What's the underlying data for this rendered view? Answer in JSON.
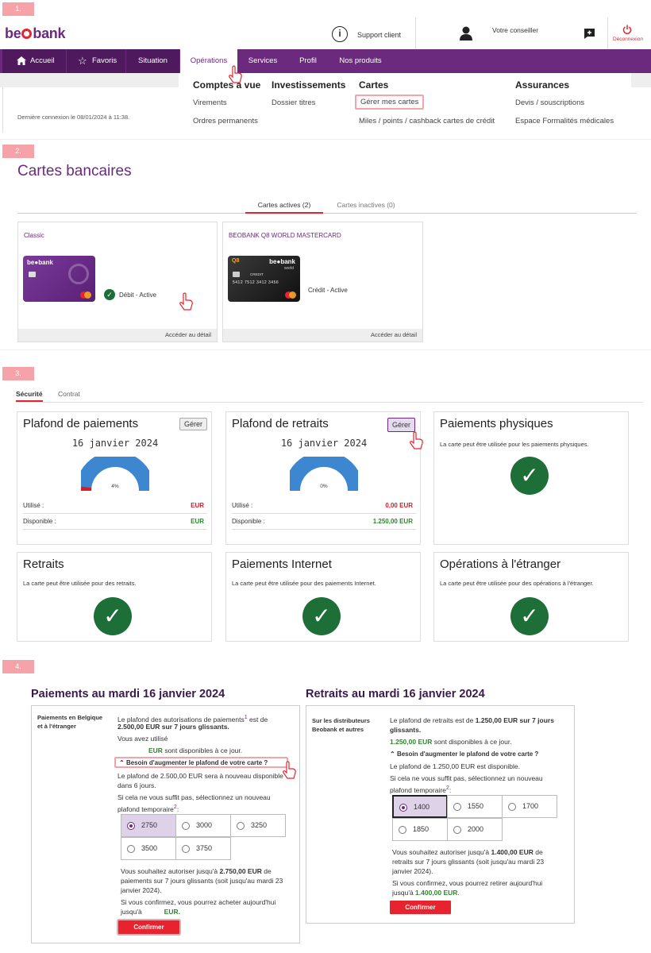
{
  "steps": [
    "1.",
    "2.",
    "3.",
    "4."
  ],
  "header": {
    "logo_pre": "be",
    "logo_post": "bank",
    "support": "Support client",
    "advisor": "Votre conseiller",
    "logout": "Déconnexion"
  },
  "nav": {
    "items": [
      "Accueil",
      "Favoris",
      "Situation",
      "Opérations",
      "Services",
      "Profil",
      "Nos produits"
    ]
  },
  "mega": {
    "heads": [
      "Comptes à vue",
      "Investissements",
      "Cartes",
      "Assurances"
    ],
    "links": {
      "virements": "Virements",
      "ordres": "Ordres permanents",
      "dossier": "Dossier titres",
      "gerer": "Gérer mes cartes",
      "miles": "Miles / points / cashback cartes de crédit",
      "devis": "Devis / souscriptions",
      "espace": "Espace Formalités médicales"
    }
  },
  "last_login": "Dernière connexion le 08/01/2024 à 11:38.",
  "cards_page": {
    "title": "Cartes bancaires",
    "tabs": [
      "Cartes actives (2)",
      "Cartes inactives (0)"
    ],
    "cards": [
      {
        "name": "Classic",
        "status": "Débit - Active",
        "detail": "Accéder au détail"
      },
      {
        "name": "BEOBANK Q8 WORLD MASTERCARD",
        "status": "Crédit - Active",
        "detail": "Accéder au détail"
      }
    ],
    "card_print": {
      "brand_pre": "be",
      "brand_post": "bank",
      "world": "world",
      "number": "5412 7512 3412 3456",
      "credit": "CREDIT",
      "q8": "Q8"
    }
  },
  "security": {
    "tabs": [
      "Sécurité",
      "Contrat"
    ],
    "payments": {
      "title": "Plafond de paiements",
      "manage": "Gérer",
      "date": "16 janvier 2024",
      "pct_label": "4%",
      "pct_used": 0.04,
      "used_label": "Utilisé :",
      "used_value": "EUR",
      "avail_label": "Disponible :",
      "avail_value": "EUR"
    },
    "withdrawals": {
      "title": "Plafond de retraits",
      "manage": "Gérer",
      "date": "16 janvier 2024",
      "pct_label": "0%",
      "pct_used": 0.0,
      "used_label": "Utilisé :",
      "used_value": "0,00 EUR",
      "avail_label": "Disponible :",
      "avail_value": "1.250,00 EUR"
    },
    "tiles": [
      {
        "title": "Paiements physiques",
        "sub": "La carte peut être utilisée pour les paiements physiques."
      },
      {
        "title": "Retraits",
        "sub": "La carte peut être utilisée pour des retraits."
      },
      {
        "title": "Paiements Internet",
        "sub": "La carte peut être utilisée pour des paiements Internet."
      },
      {
        "title": "Opérations à l'étranger",
        "sub": "La carte peut être utilisée pour des opérations à l'étranger."
      }
    ]
  },
  "limits": {
    "pay": {
      "heading": "Paiements au mardi 16 janvier 2024",
      "side": "Paiements en Belgique et à l'étranger",
      "l1a": "Le plafond des autorisations de paiements",
      "l1sup": "1",
      "l1b": " est de",
      "l2": "2.500,00 EUR sur 7 jours glissants.",
      "l3": "Vous avez utilisé",
      "l4a": "EUR",
      "l4b": " sont disponibles à ce jour.",
      "toggle": "Besoin d'augmenter le plafond de votre carte ?",
      "l5": "Le plafond de 2.500,00 EUR sera à nouveau disponible",
      "l6": "dans 6 jours.",
      "l7": "Si cela ne vous suffit pas, sélectionnez un nouveau",
      "l8": "plafond temporaire",
      "l8sup": "2",
      "l8c": ":",
      "options": [
        "2750",
        "3000",
        "3250",
        "3500",
        "3750"
      ],
      "selected": "2750",
      "s1a": "Vous souhaitez autoriser jusqu'à ",
      "s1b": "2.750,00 EUR",
      "s1c": " de",
      "s2": "paiements sur 7 jours glissants (soit jusqu'au mardi 23",
      "s3": "janvier 2024).",
      "s4": "Si vous confirmez, vous pourrez acheter aujourd'hui",
      "s5a": "jusqu'à",
      "s5b": "EUR.",
      "confirm": "Confirmer"
    },
    "wd": {
      "heading": "Retraits au mardi 16 janvier 2024",
      "side": "Sur les distributeurs Beobank et autres",
      "l1a": "Le plafond de retraits est de ",
      "l1b": "1.250,00 EUR sur 7 jours",
      "l2": "glissants.",
      "l3a": "1.250,00 EUR",
      "l3b": " sont disponibles à ce jour.",
      "toggle": "Besoin d'augmenter le plafond de votre carte ?",
      "l4": "Le plafond de 1.250,00 EUR est disponible.",
      "l5": "Si cela ne vous suffit pas, sélectionnez un nouveau",
      "l6": "plafond temporaire",
      "l6sup": "2",
      "l6c": ":",
      "options": [
        "1400",
        "1550",
        "1700",
        "1850",
        "2000"
      ],
      "selected": "1400",
      "s1a": "Vous souhaitez autoriser jusqu'à ",
      "s1b": "1.400,00 EUR",
      "s1c": " de",
      "s2": "retraits sur 7 jours glissants (soit jusqu'au mardi 23",
      "s3": "janvier 2024).",
      "s4": "Si vous confirmez, vous pourrez retirer aujourd'hui",
      "s5a": "jusqu'à ",
      "s5b": "1.400,00 EUR",
      "s5c": ".",
      "confirm": "Confirmer"
    }
  },
  "colors": {
    "brand": "#6b2a7e",
    "accent": "#e6232e",
    "ok": "#1d6e37",
    "gauge": "#3d86d0"
  },
  "icons": [
    "home-icon",
    "star-icon",
    "info-icon",
    "user-icon",
    "chat-plus-icon",
    "power-icon",
    "check-icon",
    "chevron-up-icon",
    "hand-pointer-icon"
  ]
}
